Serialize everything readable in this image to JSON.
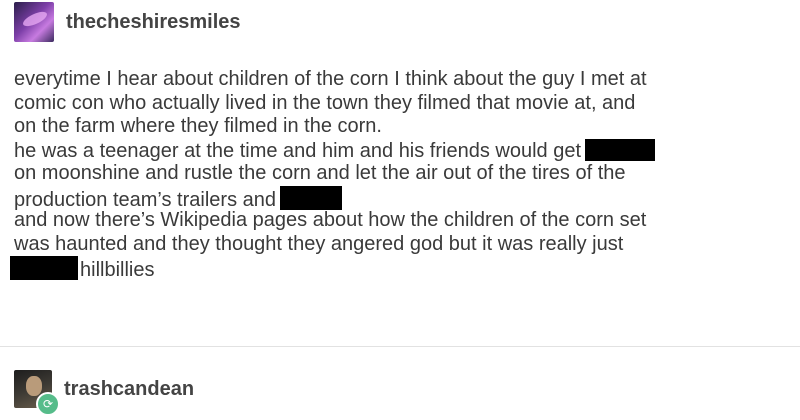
{
  "post": {
    "username": "thecheshiresmiles",
    "lines": [
      "everytime I hear about children of the corn I think about the guy I met at",
      "comic con who actually lived in the town they filmed that movie at, and",
      "on the farm where they filmed in the corn.",
      "he was a teenager at the time and him and his friends would get",
      "on moonshine and rustle the corn and let the air out of the tires of the",
      "production team’s trailers and",
      "and now there’s Wikipedia pages about how the children of the corn set",
      "was haunted and they thought they angered god but it was really just",
      "hillbillies"
    ]
  },
  "reblog": {
    "username": "trashcandean",
    "badge_icon": "reblog-icon"
  }
}
